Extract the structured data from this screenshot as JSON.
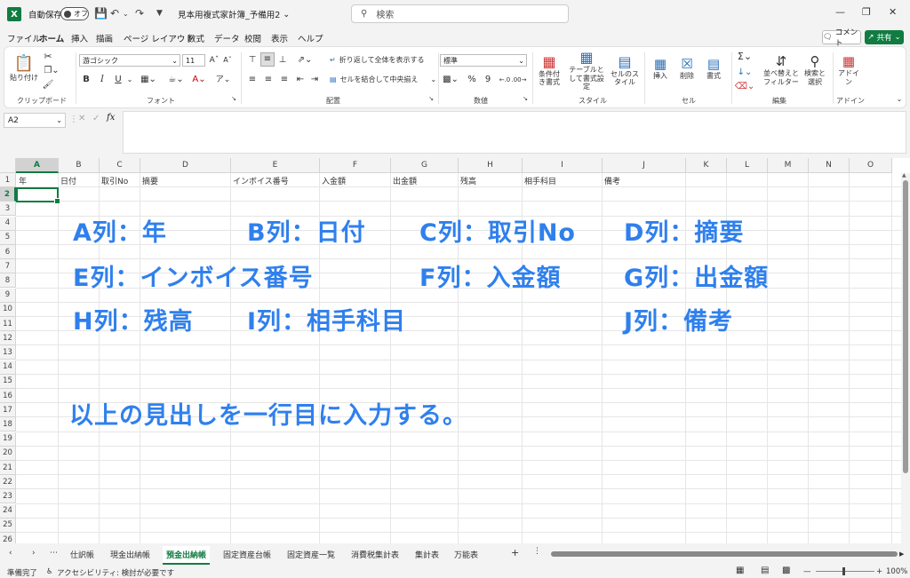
{
  "app": {
    "logo_letter": "X",
    "autosave_label": "自動保存",
    "autosave_state": "オフ",
    "doc_title": "見本用複式家計簿_予備用2",
    "search_placeholder": "検索"
  },
  "menu": [
    "ファイル",
    "ホーム",
    "挿入",
    "描画",
    "ページ レイアウト",
    "数式",
    "データ",
    "校閲",
    "表示",
    "ヘルプ"
  ],
  "menu_active": "ホーム",
  "comment_label": "コメント",
  "share_label": "共有",
  "ribbon": {
    "clipboard": {
      "paste": "貼り付け",
      "group": "クリップボード"
    },
    "font": {
      "name": "游ゴシック",
      "size": "11",
      "group": "フォント",
      "bold": "B",
      "italic": "I",
      "underline": "U"
    },
    "alignment": {
      "wrap": "折り返して全体を表示する",
      "merge": "セルを結合して中央揃え",
      "group": "配置"
    },
    "number": {
      "format": "標準",
      "percent": "%",
      "comma": "9",
      "group": "数値"
    },
    "styles": {
      "cond": "条件付き書式",
      "table": "テーブルとして書式設定",
      "cell": "セルのスタイル",
      "group": "スタイル"
    },
    "cells": {
      "insert": "挿入",
      "delete": "削除",
      "format": "書式",
      "group": "セル"
    },
    "edit": {
      "sort": "並べ替えとフィルター",
      "find": "検索と選択",
      "group": "編集"
    },
    "addin": {
      "label": "アドイン",
      "group": "アドイン"
    }
  },
  "formula": {
    "name_box": "A2",
    "fx": "fx",
    "content": ""
  },
  "columns": [
    "A",
    "B",
    "C",
    "D",
    "E",
    "F",
    "G",
    "H",
    "I",
    "J",
    "K",
    "L",
    "M",
    "N",
    "O"
  ],
  "active_column": "A",
  "rows": [
    "1",
    "2",
    "3",
    "4",
    "5",
    "6",
    "7",
    "8",
    "9",
    "10",
    "11",
    "12",
    "13",
    "14",
    "15",
    "16",
    "17",
    "18",
    "19",
    "20",
    "21",
    "22",
    "23",
    "24",
    "25",
    "26"
  ],
  "active_row": "2",
  "row1": [
    "年",
    "日付",
    "取引No",
    "摘要",
    "インボイス番号",
    "入金額",
    "出金額",
    "残高",
    "相手科目",
    "備考"
  ],
  "annotations": [
    "A列：年",
    "B列：日付",
    "C列：取引No",
    "D列：摘要",
    "E列：インボイス番号",
    "F列：入金額",
    "G列：出金額",
    "H列：残高",
    "I列：相手科目",
    "J列：備考",
    "以上の見出しを一行目に入力する。"
  ],
  "annotation_color": "#2f80ed",
  "sheets": [
    "仕訳帳",
    "現金出納帳",
    "預金出納帳",
    "固定資産台帳",
    "固定資産一覧",
    "消費税集計表",
    "集計表",
    "万能表"
  ],
  "active_sheet": "預金出納帳",
  "status": {
    "ready": "準備完了",
    "accessibility": "アクセシビリティ: 検討が必要です",
    "zoom": "100%"
  },
  "accent": "#107c41"
}
